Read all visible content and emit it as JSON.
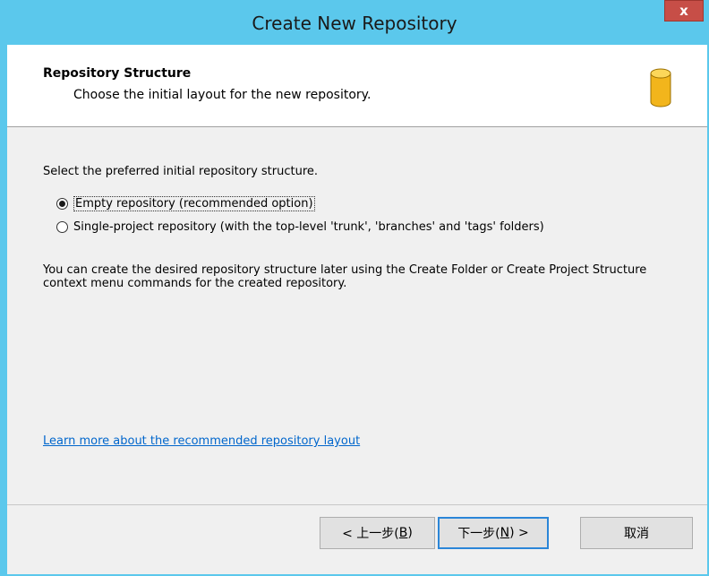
{
  "window": {
    "title": "Create New Repository",
    "close_label": "x"
  },
  "header": {
    "title": "Repository Structure",
    "subtitle": "Choose the initial layout for the new repository.",
    "icon": "database-icon"
  },
  "content": {
    "prompt": "Select the preferred initial repository structure.",
    "options": [
      {
        "label": "Empty repository (recommended option)",
        "checked": true,
        "mnemonic": "E"
      },
      {
        "label": "Single-project repository (with the top-level 'trunk', 'branches' and 'tags' folders)",
        "checked": false,
        "mnemonic": "S"
      }
    ],
    "info": "You can create the desired repository structure later using the Create Folder or Create Project Structure context menu commands for the created repository.",
    "link": "Learn more about the recommended repository layout"
  },
  "buttons": {
    "back": {
      "prefix": "< 上一步(",
      "mnemonic": "B",
      "suffix": ")"
    },
    "next": {
      "prefix": "下一步(",
      "mnemonic": "N",
      "suffix": ") >"
    },
    "cancel": "取消"
  },
  "colors": {
    "titlebar": "#5bc8ec",
    "close": "#c74e47",
    "link": "#0066cc",
    "focus": "#2b86d8"
  }
}
